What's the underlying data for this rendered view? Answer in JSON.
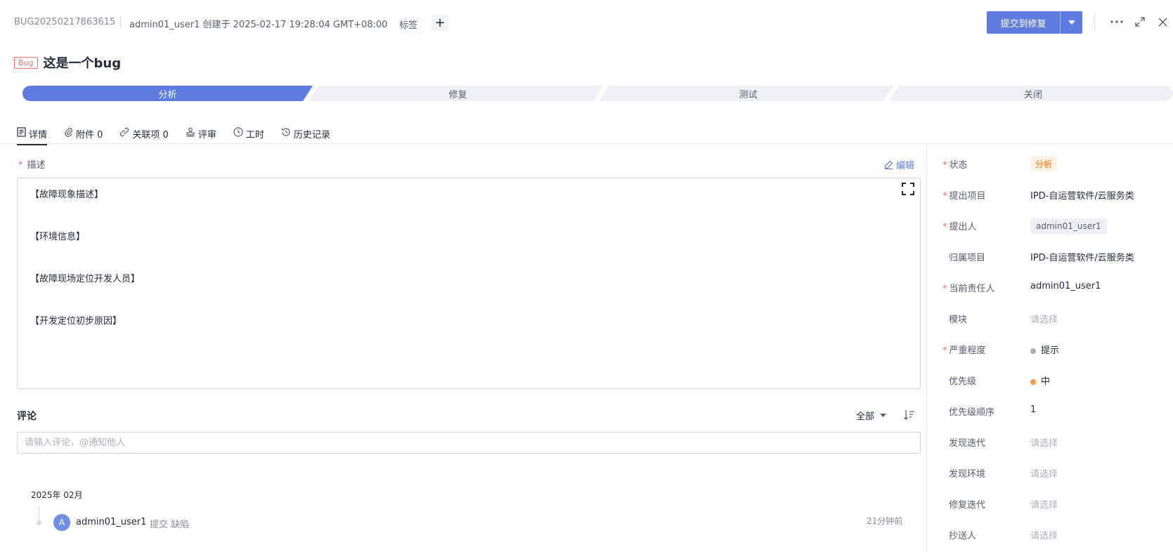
{
  "header": {
    "bug_id": "BUG20250217863615",
    "meta": "admin01_user1 创建于 2025-02-17 19:28:04 GMT+08:00",
    "tag_label": "标签",
    "add_tag_symbol": "+",
    "submit_button": "提交到修复",
    "more_icon": "⋯",
    "expand_icon": "⤢",
    "close_icon": "✕"
  },
  "title": {
    "badge": "Bug",
    "text": "这是一个bug"
  },
  "workflow": {
    "steps": [
      "分析",
      "修复",
      "测试",
      "关闭"
    ],
    "active_step": "分析",
    "active_color": "#5e7ce0"
  },
  "tabs": [
    {
      "label": "详情",
      "icon": "detail-icon",
      "active": true
    },
    {
      "label": "附件 0",
      "icon": "paperclip-icon"
    },
    {
      "label": "关联项 0",
      "icon": "link-icon"
    },
    {
      "label": "评审",
      "icon": "stamp-icon"
    },
    {
      "label": "工时",
      "icon": "clock-icon"
    },
    {
      "label": "历史记录",
      "icon": "history-icon"
    }
  ],
  "description": {
    "label": "描述",
    "required": "*",
    "edit_label": "编辑",
    "lines": [
      "【故障现象描述】",
      "【环境信息】",
      "【故障现场定位开发人员】",
      "【开发定位初步原因】"
    ]
  },
  "comments": {
    "title": "评论",
    "filter": "全部",
    "input_placeholder": "请输入评论，@通知他人",
    "month": "2025年 02月",
    "activity": {
      "avatar_letter": "A",
      "user": "admin01_user1",
      "action": "提交 缺陷",
      "time": "21分钟前"
    }
  },
  "fields": [
    {
      "label": "状态",
      "required": true,
      "value": "分析",
      "kind": "status"
    },
    {
      "label": "提出项目",
      "required": true,
      "value": "IPD-自运营软件/云服务类",
      "kind": "text"
    },
    {
      "label": "提出人",
      "required": true,
      "value": "admin01_user1",
      "kind": "chip"
    },
    {
      "label": "归属项目",
      "required": false,
      "value": "IPD-自运营软件/云服务类",
      "kind": "text"
    },
    {
      "label": "当前责任人",
      "required": true,
      "value": "admin01_user1",
      "kind": "text"
    },
    {
      "label": "模块",
      "required": false,
      "value": "请选择",
      "kind": "placeholder"
    },
    {
      "label": "严重程度",
      "required": true,
      "value": "提示",
      "kind": "dot",
      "dot_color": "#a9acb3"
    },
    {
      "label": "优先级",
      "required": false,
      "value": "中",
      "kind": "dot",
      "dot_color": "#fa9841"
    },
    {
      "label": "优先级顺序",
      "required": false,
      "value": "1",
      "kind": "text"
    },
    {
      "label": "发现迭代",
      "required": false,
      "value": "请选择",
      "kind": "placeholder"
    },
    {
      "label": "发现环境",
      "required": false,
      "value": "请选择",
      "kind": "placeholder"
    },
    {
      "label": "修复迭代",
      "required": false,
      "value": "请选择",
      "kind": "placeholder"
    },
    {
      "label": "抄送人",
      "required": false,
      "value": "请选择",
      "kind": "placeholder"
    }
  ]
}
